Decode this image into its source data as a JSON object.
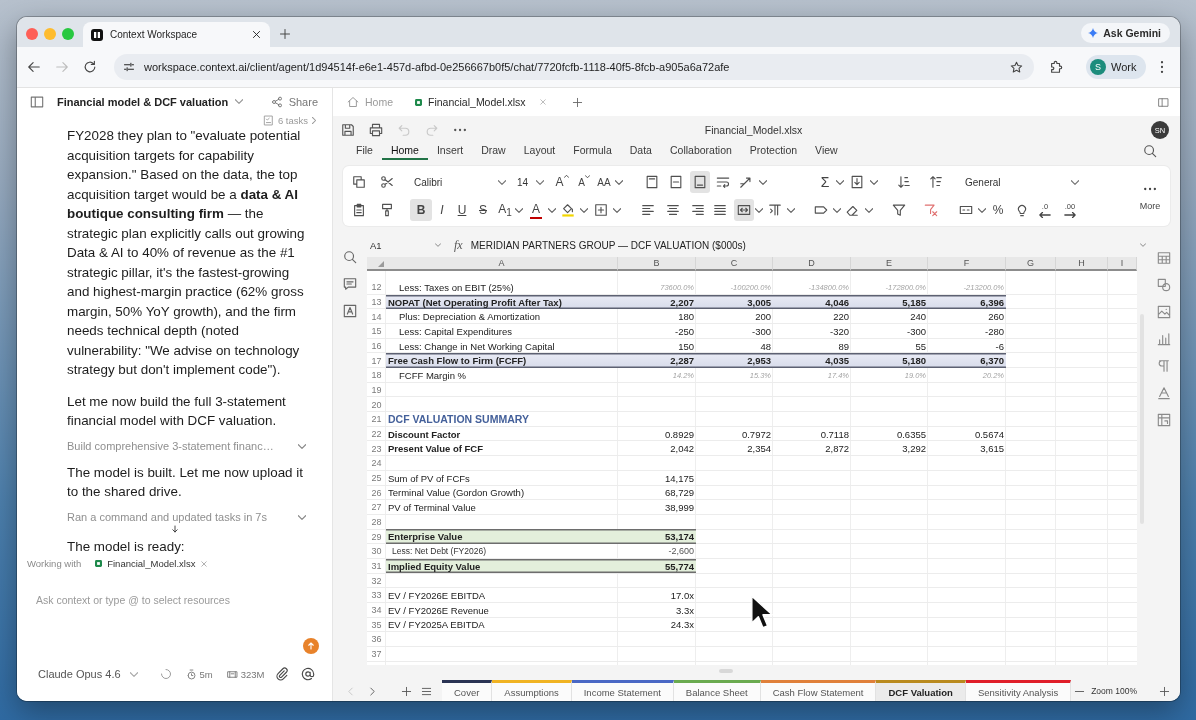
{
  "browser": {
    "tabs": [
      {
        "title": "Context Workspace",
        "selected": true
      }
    ],
    "ask_button": "Ask Gemini",
    "forward_disabled": true,
    "url": "workspace.context.ai/client/agent/1d94514f-e6e1-457d-afbd-0e256667b0f5/chat/7720fcfb-1118-40f5-8fcb-a905a6a72afe",
    "profile": {
      "initial": "S",
      "name": "Work"
    }
  },
  "chat": {
    "title": "Financial model & DCF valuation",
    "share": "Share",
    "tasks_badge": "6 tasks",
    "messages": [
      {
        "kind": "text",
        "text": "FY2028 they plan to \"evaluate potential acquisition targets for capability expansion.\" Based on the data, the top acquisition target would be a **data & AI boutique consulting firm** — the strategic plan explicitly calls out growing Data & AI to 40% of revenue as the #1 strategic pillar, it's the fastest-growing and highest-margin practice (62% gross margin, 50% YoY growth), and the firm needs technical depth (noted vulnerability: \"We advise on technology strategy but don't implement code\")."
      },
      {
        "kind": "text",
        "text": "Let me now build the full 3-statement financial model with DCF valuation."
      },
      {
        "kind": "tool",
        "text": "Build comprehensive 3-statement financ…"
      },
      {
        "kind": "text",
        "text": "The model is built. Let me now upload it to the shared drive."
      },
      {
        "kind": "tool",
        "text": "Ran a command and updated tasks in 7s"
      },
      {
        "kind": "text",
        "text": "The model is ready:"
      }
    ],
    "context": {
      "label": "Working with",
      "file": "Financial_Model.xlsx"
    },
    "input": {
      "placeholder": "Ask context or type @ to select resources"
    },
    "model": "Claude Opus 4.6",
    "busy": true,
    "stats": [
      {
        "kind": "time",
        "text": "5m"
      },
      {
        "kind": "memory",
        "text": "323M"
      }
    ]
  },
  "workspace_tabs": [
    {
      "kind": "home",
      "label": "Home",
      "selected": false
    },
    {
      "kind": "file",
      "label": "Financial_Model.xlsx",
      "selected": true
    }
  ],
  "spreadsheet": {
    "title": "Financial_Model.xlsx",
    "user_initials": "SN",
    "undo_disabled": true,
    "redo_disabled": true,
    "menu": [
      {
        "label": "File",
        "selected": false
      },
      {
        "label": "Home",
        "selected": true
      },
      {
        "label": "Insert",
        "selected": false
      },
      {
        "label": "Draw",
        "selected": false
      },
      {
        "label": "Layout",
        "selected": false
      },
      {
        "label": "Formula",
        "selected": false
      },
      {
        "label": "Data",
        "selected": false
      },
      {
        "label": "Collaboration",
        "selected": false
      },
      {
        "label": "Protection",
        "selected": false
      },
      {
        "label": "View",
        "selected": false
      }
    ],
    "ribbon": {
      "font": "Calibri",
      "font_size": "14",
      "number_format": "General",
      "more": "More",
      "glyphs": {
        "grow_font": "A",
        "shrink_font": "A",
        "change_case": "AA",
        "bold": "B",
        "italic": "I",
        "underline": "U",
        "strikethrough": "S",
        "subscript": "A$_{1}$",
        "font_color": "A",
        "autosum": "Σ",
        "percent": "%",
        "decrease_decimal": ".0",
        "increase_decimal": ".00"
      },
      "selection": {
        "bold": true,
        "align_top": false,
        "align_middle": false,
        "align_bottom": true,
        "merged": true
      }
    },
    "formula_bar": {
      "cell": "A1",
      "function_label": "fx",
      "formula": "MERIDIAN PARTNERS GROUP — DCF VALUATION ($000s)"
    },
    "columns": [
      "A",
      "B",
      "C",
      "D",
      "E",
      "F",
      "G",
      "H",
      "I"
    ],
    "rows": [
      {
        "number": "12",
        "kind": "ratio",
        "label": "Less: Taxes on EBIT (25%)",
        "values": [
          "73600.0%",
          "-100200.0%",
          "-134800.0%",
          "-172800.0%",
          "-213200.0%"
        ]
      },
      {
        "number": "13",
        "kind": "total",
        "label": "NOPAT (Net Operating Profit After Tax)",
        "values": [
          "2,207",
          "3,005",
          "4,046",
          "5,185",
          "6,396"
        ]
      },
      {
        "number": "14",
        "kind": "item",
        "label": "Plus: Depreciation & Amortization",
        "values": [
          "180",
          "200",
          "220",
          "240",
          "260"
        ]
      },
      {
        "number": "15",
        "kind": "item",
        "label": "Less: Capital Expenditures",
        "values": [
          "-250",
          "-300",
          "-320",
          "-300",
          "-280"
        ]
      },
      {
        "number": "16",
        "kind": "item",
        "label": "Less: Change in Net Working Capital",
        "values": [
          "150",
          "48",
          "89",
          "55",
          "-6"
        ]
      },
      {
        "number": "17",
        "kind": "total",
        "label": "Free Cash Flow to Firm (FCFF)",
        "values": [
          "2,287",
          "2,953",
          "4,035",
          "5,180",
          "6,370"
        ]
      },
      {
        "number": "18",
        "kind": "ratio",
        "label": "FCFF Margin %",
        "values": [
          "14.2%",
          "15.3%",
          "17.4%",
          "19.0%",
          "20.2%"
        ]
      },
      {
        "number": "19",
        "kind": "blank"
      },
      {
        "number": "20",
        "kind": "blank"
      },
      {
        "number": "21",
        "kind": "heading",
        "label": "DCF VALUATION SUMMARY"
      },
      {
        "number": "22",
        "kind": "key",
        "label": "Discount Factor",
        "values": [
          "0.8929",
          "0.7972",
          "0.7118",
          "0.6355",
          "0.5674"
        ]
      },
      {
        "number": "23",
        "kind": "key",
        "label": "Present Value of FCF",
        "values": [
          "2,042",
          "2,354",
          "2,872",
          "3,292",
          "3,615"
        ]
      },
      {
        "number": "24",
        "kind": "blank"
      },
      {
        "number": "25",
        "kind": "plain",
        "label": "Sum of PV of FCFs",
        "values": [
          "14,175"
        ]
      },
      {
        "number": "26",
        "kind": "plain",
        "label": "Terminal Value (Gordon Growth)",
        "values": [
          "68,729"
        ]
      },
      {
        "number": "27",
        "kind": "plain",
        "label": "PV of Terminal Value",
        "values": [
          "38,999"
        ]
      },
      {
        "number": "28",
        "kind": "blank"
      },
      {
        "number": "29",
        "kind": "result",
        "label": "Enterprise Value",
        "values": [
          "53,174"
        ]
      },
      {
        "number": "30",
        "kind": "adjustment",
        "label": "Less: Net Debt (FY2026)",
        "values": [
          "-2,600"
        ]
      },
      {
        "number": "31",
        "kind": "result",
        "label": "Implied Equity Value",
        "values": [
          "55,774"
        ]
      },
      {
        "number": "32",
        "kind": "blank"
      },
      {
        "number": "33",
        "kind": "plain",
        "label": "EV / FY2026E EBITDA",
        "values": [
          "17.0x"
        ]
      },
      {
        "number": "34",
        "kind": "plain",
        "label": "EV / FY2026E Revenue",
        "values": [
          "3.3x"
        ]
      },
      {
        "number": "35",
        "kind": "plain",
        "label": "EV / FY2025A EBITDA",
        "values": [
          "24.3x"
        ]
      },
      {
        "number": "36",
        "kind": "blank"
      },
      {
        "number": "37",
        "kind": "blank"
      }
    ],
    "previous_disabled": true,
    "sheets": [
      {
        "label": "Cover",
        "color": "#2b3454",
        "selected": false
      },
      {
        "label": "Assumptions",
        "color": "#f0b323",
        "selected": false
      },
      {
        "label": "Income Statement",
        "color": "#4a68c5",
        "selected": false
      },
      {
        "label": "Balance Sheet",
        "color": "#6aaa4f",
        "selected": false
      },
      {
        "label": "Cash Flow Statement",
        "color": "#e0803a",
        "selected": false
      },
      {
        "label": "DCF Valuation",
        "color": "#b98a1e",
        "selected": true
      },
      {
        "label": "Sensitivity Analysis",
        "color": "#e01e2a",
        "selected": false
      }
    ],
    "zoom": "Zoom 100%"
  }
}
